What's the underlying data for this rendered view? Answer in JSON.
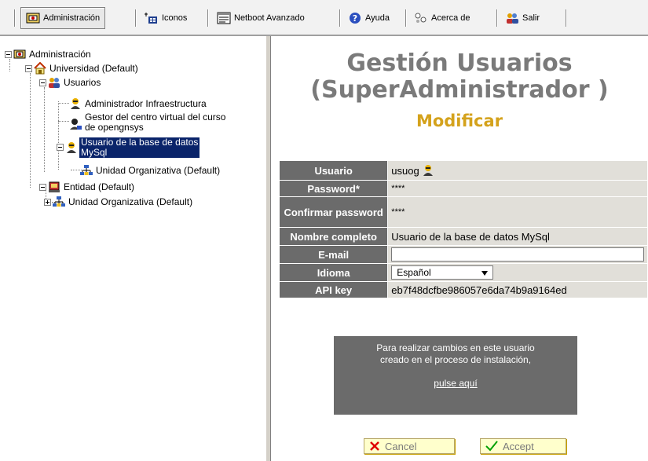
{
  "toolbar": {
    "items": [
      {
        "label": "Administración",
        "icon": "admin-icon"
      },
      {
        "label": "Iconos",
        "icon": "icons-icon"
      },
      {
        "label": "Netboot Avanzado",
        "icon": "netboot-icon"
      },
      {
        "label": "Ayuda",
        "icon": "help-icon"
      },
      {
        "label": "Acerca de",
        "icon": "about-icon"
      },
      {
        "label": "Salir",
        "icon": "exit-icon"
      }
    ]
  },
  "tree": {
    "root": "Administración",
    "university": "Universidad (Default)",
    "users_folder": "Usuarios",
    "user_admin_infra": "Administrador Infraestructura",
    "user_gestor_line1": "Gestor del centro virtual del curso",
    "user_gestor_line2": "de opengnsys",
    "user_db_line1": "Usuario de la base de datos",
    "user_db_line2": "MySql",
    "org_unit_child": "Unidad Organizativa (Default)",
    "entity": "Entidad (Default)",
    "org_unit": "Unidad Organizativa (Default)"
  },
  "page": {
    "title_line1": "Gestión Usuarios",
    "title_line2": "(SuperAdministrador )",
    "subtitle": "Modificar"
  },
  "form": {
    "user_label": "Usuario",
    "user_value": "usuog",
    "password_label": "Password*",
    "password_value": "****",
    "confirm_label": "Confirmar password",
    "confirm_value": "****",
    "fullname_label": "Nombre completo",
    "fullname_value": "Usuario de la base de datos MySql",
    "email_label": "E-mail",
    "email_value": "",
    "language_label": "Idioma",
    "language_value": "Español",
    "apikey_label": "API key",
    "apikey_value": "eb7f48dcfbe986057e6da74b9a9164ed"
  },
  "info": {
    "line1": "Para realizar cambios en este usuario",
    "line2": "creado en el proceso de instalación,",
    "link": "pulse aquí"
  },
  "buttons": {
    "cancel": "Cancel",
    "accept": "Accept"
  },
  "colors": {
    "label_bg": "#6b6b6b",
    "value_bg": "#e1dfd9",
    "title": "#7a7a7a",
    "subtitle": "#d4a21c",
    "selection": "#0a246a",
    "button_bg": "#ffffcc"
  }
}
